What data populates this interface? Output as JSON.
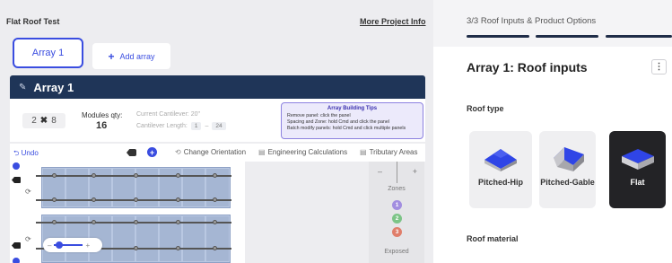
{
  "header": {
    "project_name": "Flat Roof Test",
    "more_info": "More Project Info"
  },
  "arrays": {
    "tab_label": "Array 1",
    "add_label": "Add array"
  },
  "array_panel": {
    "title": "Array 1",
    "rows": "2",
    "cols": "8",
    "modules_qty_label": "Modules qty:",
    "modules_qty_value": "16",
    "cantilever_label": "Current Cantilever: 20\"",
    "cantilever_length_label": "Cantilever Length:",
    "cantilever_min": "1",
    "cantilever_sep": "–",
    "cantilever_max": "24",
    "tips": {
      "title": "Array Building Tips",
      "lines": [
        "Remove panel: click the panel",
        "Spacing and Zone: hold Cmd and click the panel",
        "Batch modify panels: hold Cmd and click multiple panels"
      ]
    }
  },
  "toolbar": {
    "undo": "Undo",
    "change_orientation": "Change Orientation",
    "engineering_calculations": "Engineering Calculations",
    "tributary_areas": "Tributary Areas"
  },
  "zones": {
    "minus": "–",
    "plus": "+",
    "label": "Zones",
    "items": [
      {
        "label": "1",
        "color": "#a28ee0"
      },
      {
        "label": "2",
        "color": "#7cc487"
      },
      {
        "label": "3",
        "color": "#e07e6b"
      }
    ],
    "exposed": "Exposed"
  },
  "zoom": {
    "minus": "–",
    "plus": "+",
    "level": 0.1
  },
  "right_panel": {
    "step": "3/3 Roof Inputs & Product Options",
    "progress_steps": 3,
    "title": "Array 1: Roof inputs",
    "menu": "⋮",
    "roof_type_label": "Roof type",
    "roof_types": [
      {
        "label": "Pitched-Hip",
        "selected": false
      },
      {
        "label": "Pitched-Gable",
        "selected": false
      },
      {
        "label": "Flat",
        "selected": true
      }
    ],
    "roof_material_label": "Roof material"
  },
  "colors": {
    "accent": "#3a4de0",
    "header_bar": "#1f3558",
    "panel": "#a5b6d3",
    "selected_card": "#232326"
  }
}
